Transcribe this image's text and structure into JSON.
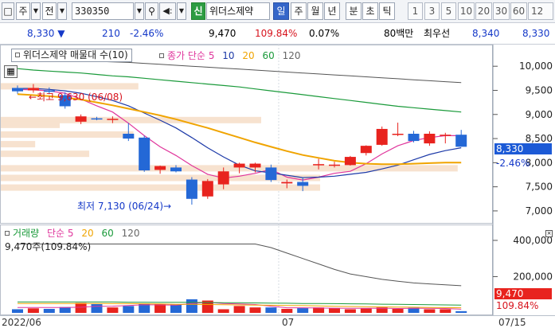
{
  "toolbar": {
    "market_label": "주",
    "code_prefix_label": "전",
    "code_value": "330350",
    "stock_name": "위더스제약",
    "chart_type_active": "일",
    "periods": [
      "주",
      "월",
      "년",
      "분",
      "초",
      "틱"
    ],
    "intervals": [
      "1",
      "3",
      "5",
      "10",
      "20",
      "30",
      "60",
      "12"
    ],
    "new_label": "신"
  },
  "quote": {
    "price": "8,330",
    "change": "210",
    "change_pct": "-2.46%",
    "volume_price": "9,470",
    "volume_ratio": "109.84%",
    "turnover": "0.07%",
    "trade_amount": "80백만",
    "best_ask_label": "최우선",
    "best_ask": "8,340",
    "best_bid": "8,330"
  },
  "price_panel": {
    "legend_title": "위더스제약 매물대 수(10)",
    "ma_legend_label": "종가 단순",
    "ma_periods": [
      "5",
      "10",
      "20",
      "60",
      "120"
    ],
    "high_annotation": "최고 9,630 (06/08)",
    "low_annotation": "최저 7,130 (06/24)",
    "current_price_tag": "8,330",
    "current_change_tag": "-2.46%"
  },
  "volume_panel": {
    "legend_label": "거래량",
    "ma_legend_label": "단순",
    "ma_periods": [
      "5",
      "20",
      "60",
      "120"
    ],
    "current_volume_text": "9,470주(109.84%)",
    "current_volume_tag": "9,470",
    "current_ratio_tag": "109.84%"
  },
  "x_axis": {
    "labels": [
      "2022/06",
      "07",
      "07/15"
    ]
  },
  "colors": {
    "up": "#e8231e",
    "down": "#2468d6",
    "ma5": "#e0369c",
    "ma10": "#1d3aa8",
    "ma20": "#f0a400",
    "ma60": "#1a9a3a",
    "ma120": "#555555",
    "volume_profile": "#f7e2cf"
  },
  "chart_data": [
    {
      "type": "candlestick",
      "title": "위더스제약 매물대 수(10)",
      "y_axis_ticks": [
        "10,000",
        "9,500",
        "9,000",
        "8,500",
        "8,000",
        "7,500",
        "7,000"
      ],
      "ylim": [
        6850,
        10350
      ],
      "x_start": "2022/06",
      "annotations": [
        {
          "text": "최고 9,630 (06/08)",
          "value": 9630
        },
        {
          "text": "최저 7,130 (06/24)",
          "value": 7130
        }
      ],
      "candles": [
        {
          "o": 9550,
          "h": 9600,
          "l": 9430,
          "c": 9480
        },
        {
          "o": 9500,
          "h": 9630,
          "l": 9450,
          "c": 9550
        },
        {
          "o": 9500,
          "h": 9560,
          "l": 9420,
          "c": 9470
        },
        {
          "o": 9400,
          "h": 9460,
          "l": 9120,
          "c": 9170
        },
        {
          "o": 8850,
          "h": 9000,
          "l": 8800,
          "c": 8960
        },
        {
          "o": 8920,
          "h": 8950,
          "l": 8880,
          "c": 8900
        },
        {
          "o": 8900,
          "h": 8960,
          "l": 8820,
          "c": 8910
        },
        {
          "o": 8600,
          "h": 8820,
          "l": 8450,
          "c": 8500
        },
        {
          "o": 8520,
          "h": 8560,
          "l": 7810,
          "c": 7840
        },
        {
          "o": 7850,
          "h": 7940,
          "l": 7770,
          "c": 7930
        },
        {
          "o": 7900,
          "h": 7950,
          "l": 7800,
          "c": 7820
        },
        {
          "o": 7650,
          "h": 7700,
          "l": 7130,
          "c": 7250
        },
        {
          "o": 7300,
          "h": 7660,
          "l": 7250,
          "c": 7620
        },
        {
          "o": 7550,
          "h": 7900,
          "l": 7450,
          "c": 7820
        },
        {
          "o": 7900,
          "h": 8000,
          "l": 7780,
          "c": 7980
        },
        {
          "o": 7900,
          "h": 8000,
          "l": 7800,
          "c": 7980
        },
        {
          "o": 7900,
          "h": 7960,
          "l": 7600,
          "c": 7640
        },
        {
          "o": 7570,
          "h": 7650,
          "l": 7470,
          "c": 7600
        },
        {
          "o": 7600,
          "h": 7700,
          "l": 7410,
          "c": 7520
        },
        {
          "o": 7960,
          "h": 8080,
          "l": 7860,
          "c": 7970
        },
        {
          "o": 7940,
          "h": 8020,
          "l": 7900,
          "c": 7960
        },
        {
          "o": 7950,
          "h": 8140,
          "l": 7940,
          "c": 8120
        },
        {
          "o": 8200,
          "h": 8360,
          "l": 8150,
          "c": 8350
        },
        {
          "o": 8370,
          "h": 8750,
          "l": 8350,
          "c": 8700
        },
        {
          "o": 8600,
          "h": 8830,
          "l": 8550,
          "c": 8600
        },
        {
          "o": 8600,
          "h": 8660,
          "l": 8420,
          "c": 8450
        },
        {
          "o": 8400,
          "h": 8650,
          "l": 8350,
          "c": 8600
        },
        {
          "o": 8580,
          "h": 8620,
          "l": 8400,
          "c": 8580
        },
        {
          "o": 8580,
          "h": 8680,
          "l": 8350,
          "c": 8330
        }
      ],
      "series": [
        {
          "name": "5",
          "values": [
            9520,
            9510,
            9490,
            9440,
            9320,
            9180,
            9050,
            8820,
            8560,
            8330,
            8150,
            7940,
            7760,
            7680,
            7720,
            7780,
            7860,
            7700,
            7640,
            7700,
            7780,
            7820,
            7980,
            8180,
            8350,
            8460,
            8520,
            8560,
            8560
          ]
        },
        {
          "name": "10",
          "values": [
            9540,
            9540,
            9520,
            9490,
            9440,
            9370,
            9290,
            9180,
            9030,
            8880,
            8720,
            8520,
            8310,
            8120,
            7950,
            7830,
            7790,
            7740,
            7690,
            7700,
            7720,
            7760,
            7800,
            7870,
            7950,
            8060,
            8170,
            8250,
            8310
          ]
        },
        {
          "name": "20",
          "values": [
            9420,
            9400,
            9380,
            9350,
            9310,
            9250,
            9190,
            9120,
            9050,
            8980,
            8900,
            8810,
            8720,
            8620,
            8520,
            8420,
            8330,
            8240,
            8160,
            8100,
            8040,
            8000,
            7980,
            7970,
            7970,
            7980,
            7990,
            8000,
            8000
          ]
        },
        {
          "name": "60",
          "values": [
            9950,
            9920,
            9900,
            9880,
            9860,
            9830,
            9800,
            9780,
            9750,
            9720,
            9690,
            9660,
            9630,
            9600,
            9570,
            9530,
            9490,
            9450,
            9410,
            9370,
            9330,
            9290,
            9250,
            9210,
            9170,
            9140,
            9110,
            9080,
            9050
          ]
        },
        {
          "name": "120",
          "values": [
            10150,
            10140,
            10130,
            10120,
            10110,
            10100,
            10090,
            10080,
            10060,
            10040,
            10020,
            10000,
            9980,
            9960,
            9940,
            9920,
            9900,
            9880,
            9860,
            9840,
            9820,
            9800,
            9780,
            9760,
            9740,
            9720,
            9700,
            9680,
            9660
          ]
        }
      ]
    },
    {
      "type": "bar",
      "title": "거래량",
      "y_axis_ticks": [
        "400,000",
        "200,000"
      ],
      "ylim": [
        0,
        470000
      ],
      "values": [
        20000,
        25000,
        22000,
        32000,
        55000,
        48000,
        30000,
        38000,
        52000,
        50000,
        45000,
        75000,
        68000,
        20000,
        38000,
        30000,
        30000,
        22000,
        26000,
        30000,
        25000,
        20000,
        24000,
        30000,
        22000,
        28000,
        20000,
        20000,
        9470
      ],
      "series": [
        {
          "name": "5",
          "values": [
            30000,
            30000,
            30000,
            30000,
            31000,
            36000,
            37000,
            41000,
            45000,
            44000,
            43000,
            52000,
            58000,
            52000,
            49000,
            46000,
            37000,
            28000,
            28000,
            27000,
            26000,
            25000,
            25000,
            26000,
            24000,
            25000,
            25000,
            24000,
            20000
          ]
        },
        {
          "name": "20",
          "values": [
            52000,
            52000,
            52000,
            52000,
            52000,
            52000,
            51000,
            51000,
            50000,
            49000,
            47000,
            47000,
            46000,
            45000,
            44000,
            43000,
            42000,
            41000,
            40000,
            38000,
            36000,
            35000,
            34000,
            33000,
            32000,
            31000,
            30000,
            29000,
            28000
          ]
        },
        {
          "name": "60",
          "values": [
            60000,
            60000,
            60000,
            60000,
            60000,
            60000,
            60000,
            59000,
            59000,
            58000,
            58000,
            58000,
            57000,
            56000,
            56000,
            55000,
            54000,
            53000,
            52000,
            52000,
            51000,
            50000,
            49000,
            48000,
            47000,
            46000,
            45000,
            44000,
            43000
          ]
        },
        {
          "name": "120",
          "values": [
            380000,
            380000,
            380000,
            380000,
            380000,
            380000,
            380000,
            380000,
            380000,
            380000,
            380000,
            380000,
            380000,
            380000,
            380000,
            380000,
            360000,
            330000,
            300000,
            270000,
            240000,
            215000,
            200000,
            185000,
            175000,
            165000,
            160000,
            155000,
            150000
          ]
        }
      ]
    }
  ]
}
